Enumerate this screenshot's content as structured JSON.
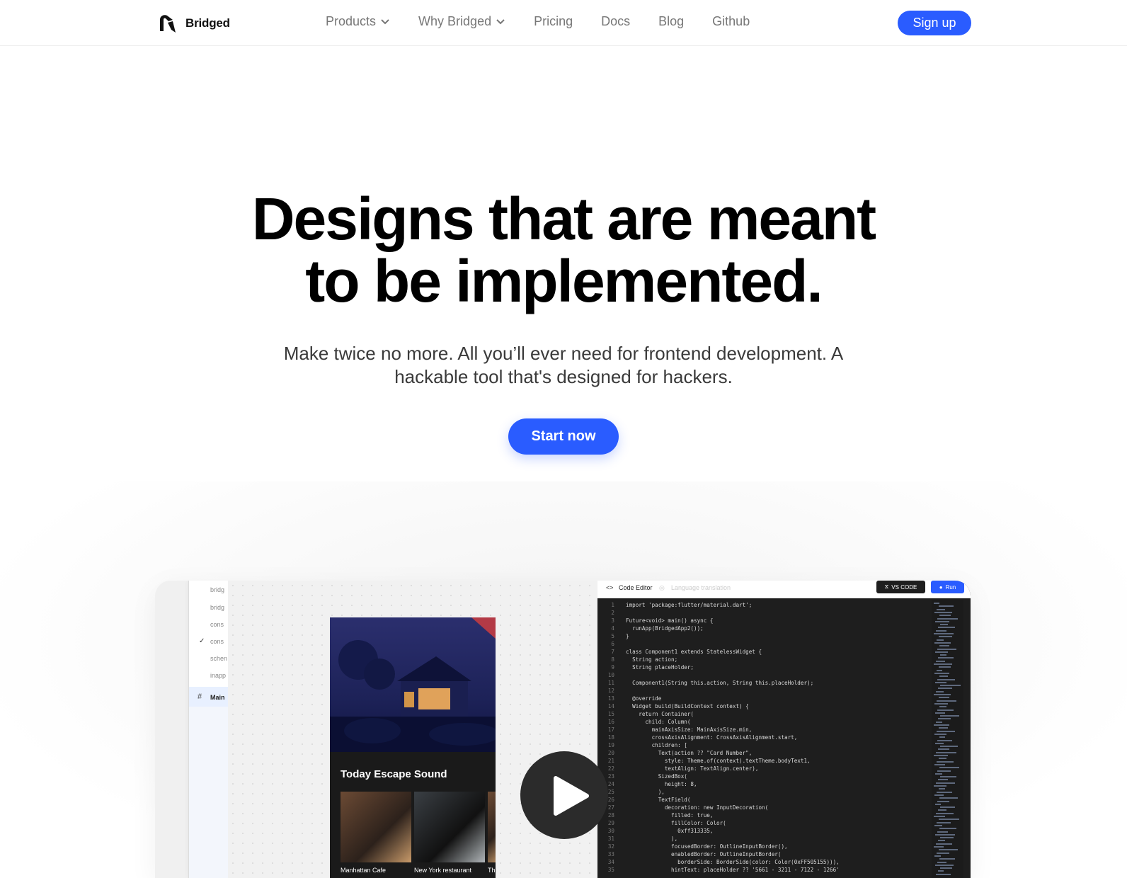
{
  "brand": {
    "name": "Bridged"
  },
  "nav": {
    "items": [
      {
        "label": "Products",
        "dropdown": true
      },
      {
        "label": "Why Bridged",
        "dropdown": true
      },
      {
        "label": "Pricing",
        "dropdown": false
      },
      {
        "label": "Docs",
        "dropdown": false
      },
      {
        "label": "Blog",
        "dropdown": false
      },
      {
        "label": "Github",
        "dropdown": false
      }
    ],
    "signup_label": "Sign up"
  },
  "hero": {
    "title_line1": "Designs that are meant",
    "title_line2": "to be implemented.",
    "subtitle_line1": "Make twice no more. All you’ll ever need for frontend development. A",
    "subtitle_line2": "hackable tool that's designed for hackers.",
    "cta_label": "Start now"
  },
  "preview": {
    "layers": [
      "bridg",
      "bridg",
      "cons",
      "cons",
      "schen",
      "inapp",
      "Main"
    ],
    "phone": {
      "title": "Today Escape Sound",
      "captions": [
        "Manhattan Cafe",
        "New York restaurant",
        "Th"
      ]
    },
    "editor": {
      "tab_code": "Code Editor",
      "tab_lang": "Language translation",
      "vscode_label": "VS CODE",
      "run_label": "Run",
      "lines": [
        "import 'package:flutter/material.dart';",
        "",
        "Future<void> main() async {",
        "  runApp(BridgedApp2());",
        "}",
        "",
        "class Component1 extends StatelessWidget {",
        "  String action;",
        "  String placeHolder;",
        "",
        "  Component1(String this.action, String this.placeHolder);",
        "",
        "  @override",
        "  Widget build(BuildContext context) {",
        "    return Container(",
        "      child: Column(",
        "        mainAxisSize: MainAxisSize.min,",
        "        crossAxisAlignment: CrossAxisAlignment.start,",
        "        children: [",
        "          Text(action ?? \"Card Number\",",
        "            style: Theme.of(context).textTheme.bodyText1,",
        "            textAlign: TextAlign.center),",
        "          SizedBox(",
        "            height: 8,",
        "          ),",
        "          TextField(",
        "            decoration: new InputDecoration(",
        "              filled: true,",
        "              fillColor: Color(",
        "                0xff313335,",
        "              ),",
        "              focusedBorder: OutlineInputBorder(),",
        "              enabledBorder: OutlineInputBorder(",
        "                borderSide: BorderSide(color: Color(0xFF505155))),",
        "              hintText: placeHolder ?? '5661 - 3211 - 7122 - 1266'"
      ]
    }
  },
  "colors": {
    "accent": "#2a5cff",
    "text": "#000000",
    "muted": "#777777"
  }
}
